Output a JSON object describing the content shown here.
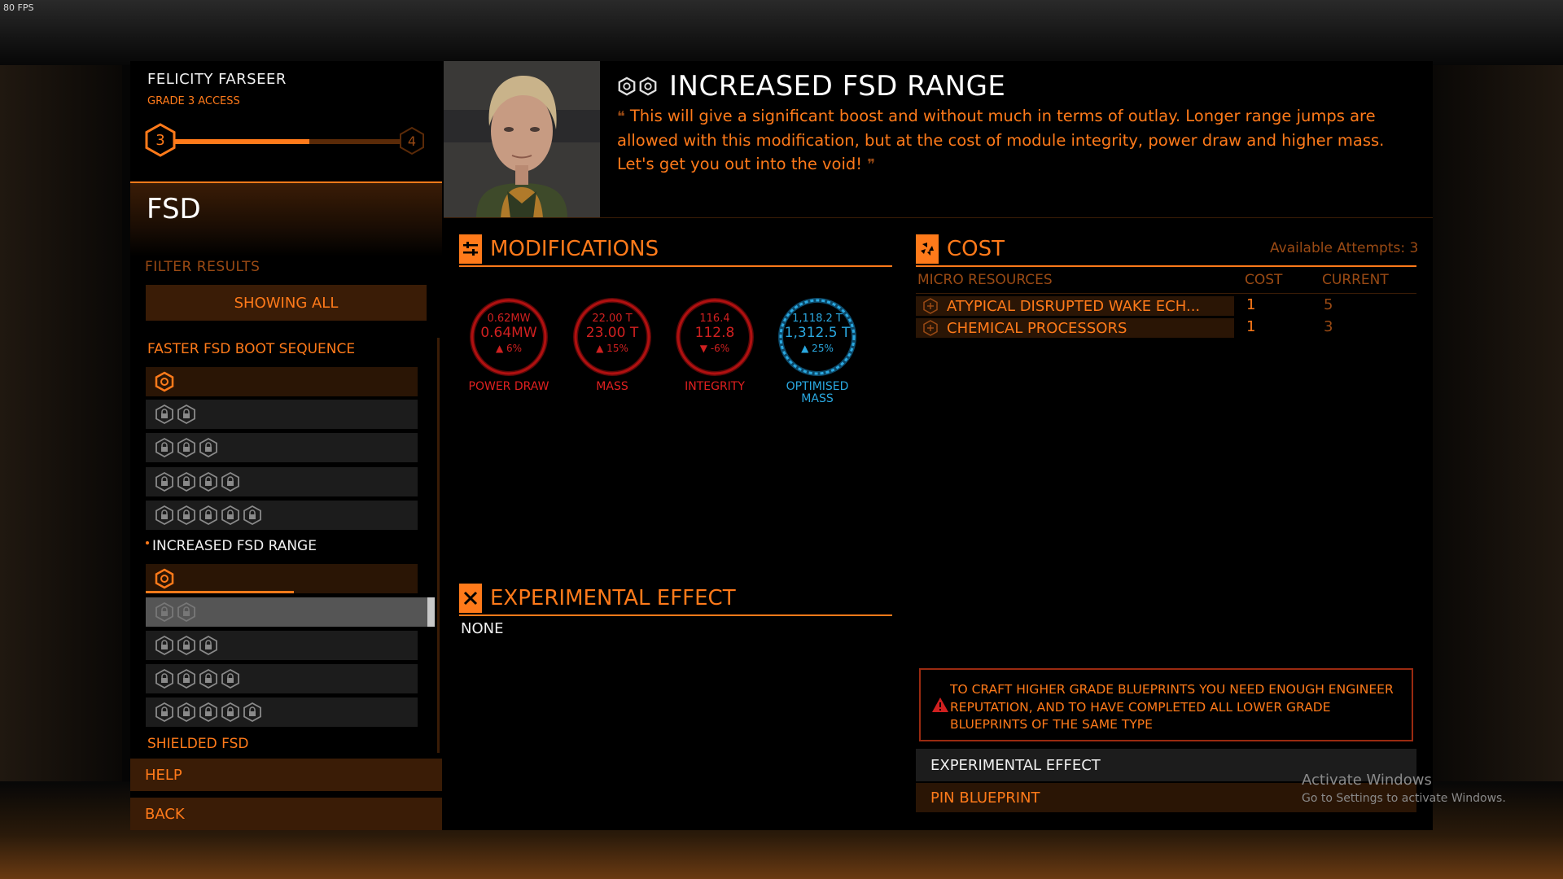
{
  "hud": {
    "fps": "80 FPS"
  },
  "engineer": {
    "name": "FELICITY FARSEER",
    "access": "GRADE 3 ACCESS",
    "current_grade": "3",
    "next_grade": "4",
    "reputation_progress": 0.59
  },
  "module": {
    "title": "FSD"
  },
  "filter": {
    "label": "FILTER RESULTS",
    "value": "SHOWING ALL"
  },
  "blueprint_groups": [
    {
      "name": "FASTER FSD BOOT SEQUENCE"
    },
    {
      "name": "INCREASED FSD RANGE"
    },
    {
      "name": "SHIELDED FSD"
    }
  ],
  "nav": {
    "help": "HELP",
    "back": "BACK"
  },
  "blueprint": {
    "title": "INCREASED FSD RANGE",
    "quote": "This will give a significant boost and without much in terms of outlay. Longer range jumps are allowed with this modification, but at the cost of module integrity, power draw and higher mass. Let's get you out into the void!"
  },
  "modifications": {
    "title": "MODIFICATIONS",
    "stats": [
      {
        "base": "0.62MW",
        "value": "0.64MW",
        "change": "▲ 6%",
        "label": "POWER DRAW",
        "tone": "negative"
      },
      {
        "base": "22.00 T",
        "value": "23.00 T",
        "change": "▲ 15%",
        "label": "MASS",
        "tone": "negative"
      },
      {
        "base": "116.4",
        "value": "112.8",
        "change": "▼ -6%",
        "label": "INTEGRITY",
        "tone": "negative"
      },
      {
        "base": "1,118.2 T",
        "value": "1,312.5 T",
        "change": "▲ 25%",
        "label": "OPTIMISED MASS",
        "tone": "positive"
      }
    ]
  },
  "experimental": {
    "title": "EXPERIMENTAL EFFECT",
    "value": "NONE"
  },
  "cost": {
    "title": "COST",
    "available_attempts": "Available Attempts: 3",
    "headers": {
      "resource": "MICRO RESOURCES",
      "cost": "COST",
      "current": "CURRENT"
    },
    "rows": [
      {
        "name": "ATYPICAL DISRUPTED WAKE ECH...",
        "cost": "1",
        "current": "5"
      },
      {
        "name": "CHEMICAL PROCESSORS",
        "cost": "1",
        "current": "3"
      }
    ]
  },
  "warning": "TO CRAFT HIGHER GRADE BLUEPRINTS YOU NEED ENOUGH ENGINEER REPUTATION, AND TO HAVE COMPLETED ALL LOWER GRADE BLUEPRINTS OF THE SAME TYPE",
  "actions": {
    "experimental": "EXPERIMENTAL EFFECT",
    "pin": "PIN BLUEPRINT"
  },
  "watermark": {
    "line1": "Activate Windows",
    "line2": "Go to Settings to activate Windows."
  },
  "colors": {
    "accent": "#ff7a1a",
    "dim_accent": "#9a4a14",
    "negative": "#d02020",
    "positive": "#2aa8e0"
  }
}
